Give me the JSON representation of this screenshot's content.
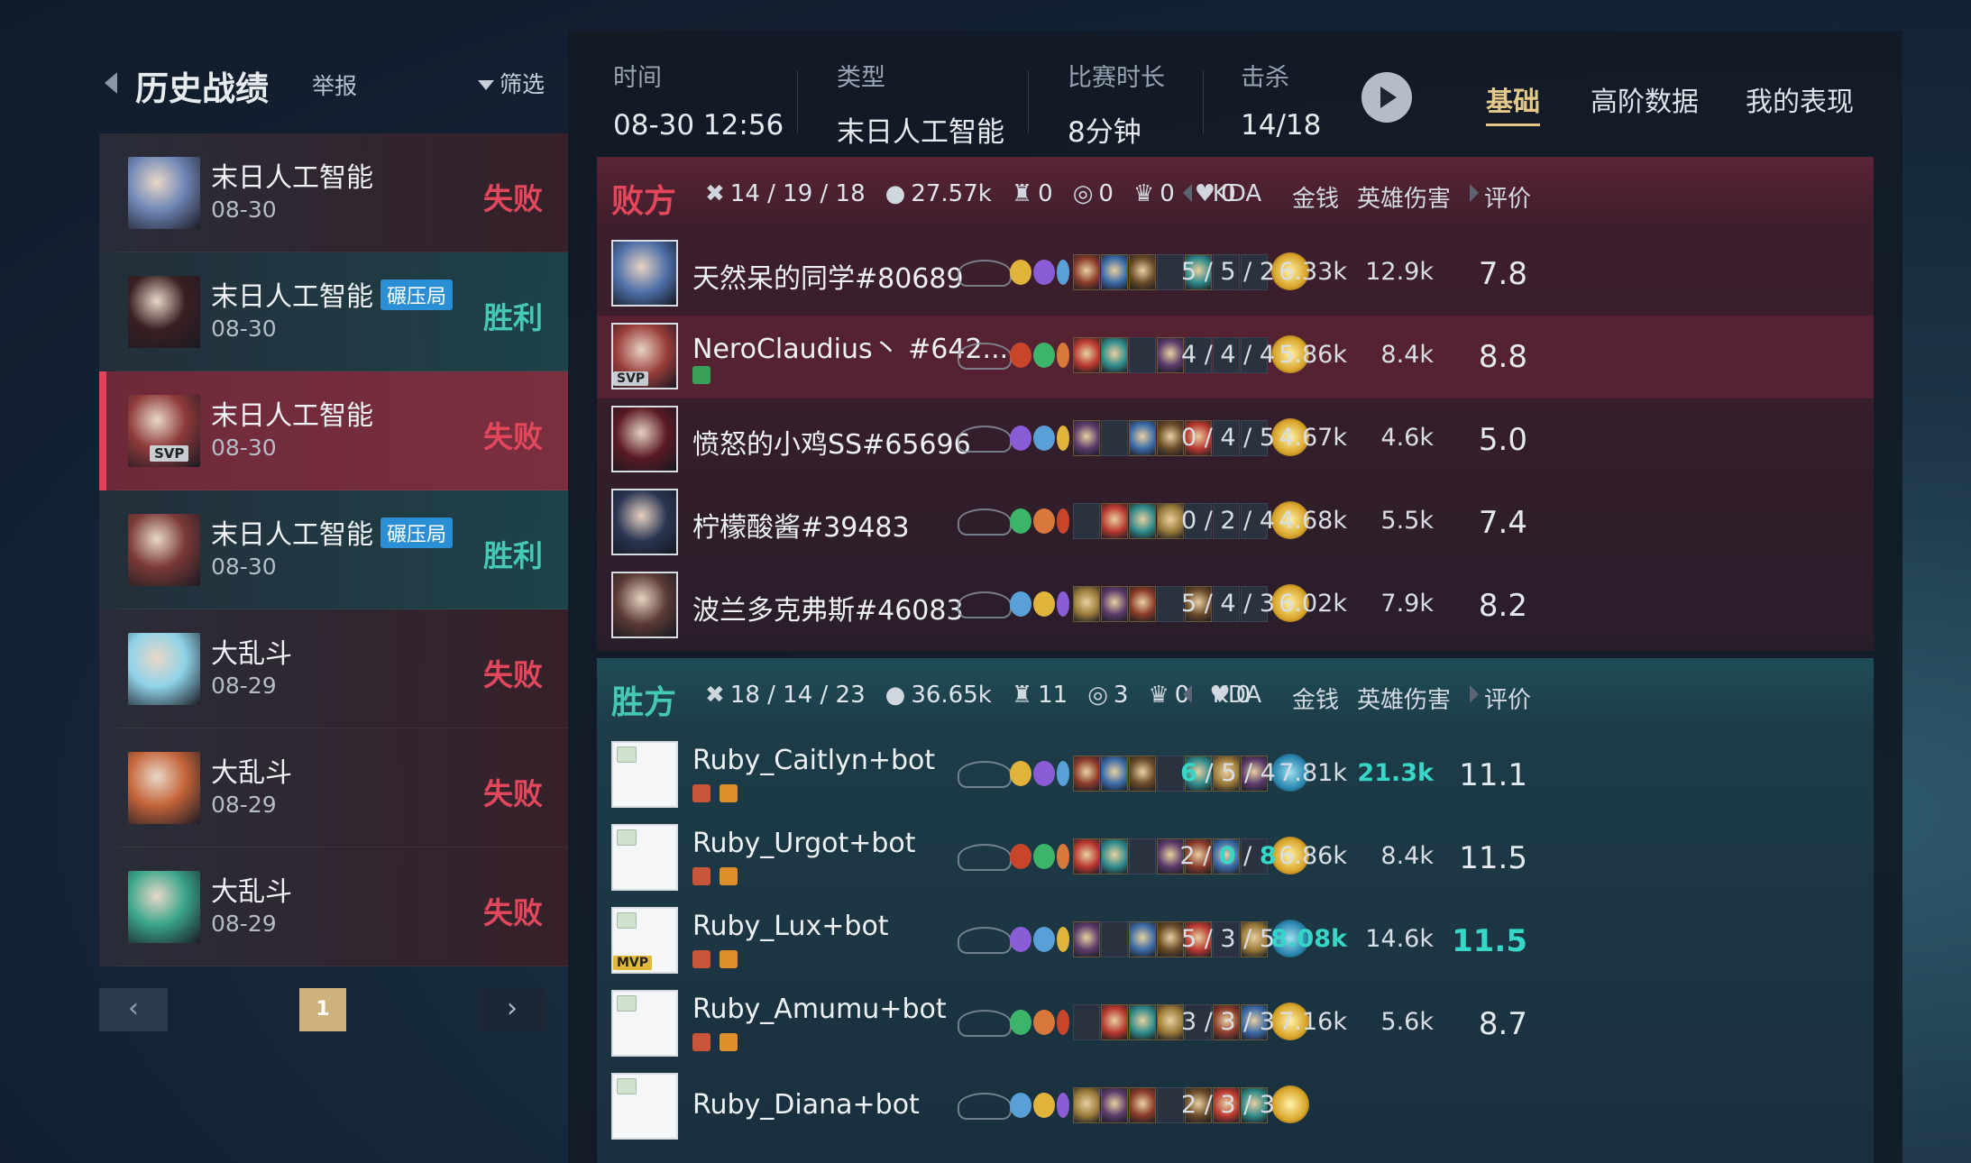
{
  "colors": {
    "lose": "#e2475c",
    "win": "#45c9b5",
    "accent_gold": "#e5c98b",
    "highlight_teal": "#37d7c7",
    "tag_blue": "#2b8fd6"
  },
  "left": {
    "title": "历史战绩",
    "report": "举报",
    "filter": "筛选",
    "matches": [
      {
        "mode": "末日人工智能",
        "tag": "",
        "date": "08-30",
        "result": "失败",
        "outcome": "lose",
        "badge": "",
        "icon_color": "#6f86b6"
      },
      {
        "mode": "末日人工智能",
        "tag": "碾压局",
        "date": "08-30",
        "result": "胜利",
        "outcome": "win",
        "badge": "",
        "icon_color": "#3a1f22"
      },
      {
        "mode": "末日人工智能",
        "tag": "",
        "date": "08-30",
        "result": "失败",
        "outcome": "lose",
        "badge": "SVP",
        "icon_color": "#8e3a3a",
        "selected": true
      },
      {
        "mode": "末日人工智能",
        "tag": "碾压局",
        "date": "08-30",
        "result": "胜利",
        "outcome": "win",
        "badge": "",
        "icon_color": "#7a3a36"
      },
      {
        "mode": "大乱斗",
        "tag": "",
        "date": "08-29",
        "result": "失败",
        "outcome": "lose",
        "badge": "",
        "icon_color": "#8fd2e8"
      },
      {
        "mode": "大乱斗",
        "tag": "",
        "date": "08-29",
        "result": "失败",
        "outcome": "lose",
        "badge": "",
        "icon_color": "#c4643a"
      },
      {
        "mode": "大乱斗",
        "tag": "",
        "date": "08-29",
        "result": "失败",
        "outcome": "lose",
        "badge": "",
        "icon_color": "#3aa58a"
      }
    ],
    "pager": {
      "prev": "‹",
      "page": "1",
      "next": "›"
    }
  },
  "info": {
    "time_label": "时间",
    "time_value": "08-30 12:56",
    "type_label": "类型",
    "type_value": "末日人工智能",
    "duration_label": "比赛时长",
    "duration_value": "8分钟",
    "kills_label": "击杀",
    "kills_value": "14/18"
  },
  "tabs": [
    "基础",
    "高阶数据",
    "我的表现"
  ],
  "columns": {
    "kda": "KDA",
    "gold": "金钱",
    "damage": "英雄伤害",
    "score": "评价"
  },
  "losing": {
    "title": "败方",
    "kda": "14 / 19 / 18",
    "gold": "27.57k",
    "towers": "0",
    "inhibs": "0",
    "barons": "0",
    "dragons": "0",
    "players": [
      {
        "name": "天然呆的同学#80689",
        "kda": "5 / 5 / 2",
        "gold": "6.33k",
        "damage": "12.9k",
        "score": "7.8",
        "avatar": "#4e6fa8",
        "badge": ""
      },
      {
        "name": "NeroClaudius丶 #642...",
        "kda": "4 / 4 / 4",
        "gold": "5.86k",
        "damage": "8.4k",
        "score": "8.8",
        "avatar": "#9a3d3a",
        "badge": "SVP",
        "highlight": true
      },
      {
        "name": "愤怒的小鸡SS#65696",
        "kda": "0 / 4 / 5",
        "gold": "4.67k",
        "damage": "4.6k",
        "score": "5.0",
        "avatar": "#5a1a24",
        "badge": ""
      },
      {
        "name": "柠檬酸酱#39483",
        "kda": "0 / 2 / 4",
        "gold": "4.68k",
        "damage": "5.5k",
        "score": "7.4",
        "avatar": "#2a3552",
        "badge": ""
      },
      {
        "name": "波兰多克弗斯#46083",
        "kda": "5 / 4 / 3",
        "gold": "6.02k",
        "damage": "7.9k",
        "score": "8.2",
        "avatar": "#5a3a34",
        "badge": ""
      }
    ]
  },
  "winning": {
    "title": "胜方",
    "kda": "18 / 14 / 23",
    "gold": "36.65k",
    "towers": "11",
    "inhibs": "3",
    "barons": "0",
    "dragons": "0",
    "players": [
      {
        "name": "Ruby_Caitlyn+bot",
        "k": "6",
        "d": "5",
        "a": "4",
        "gold": "7.81k",
        "damage": "21.3k",
        "score": "11.1",
        "badge": "",
        "hi_k": true,
        "hi_dmg": true
      },
      {
        "name": "Ruby_Urgot+bot",
        "k": "2",
        "d": "0",
        "a": "8",
        "gold": "6.86k",
        "damage": "8.4k",
        "score": "11.5",
        "badge": "",
        "hi_d": true,
        "hi_a": true
      },
      {
        "name": "Ruby_Lux+bot",
        "k": "5",
        "d": "3",
        "a": "5",
        "gold": "8.08k",
        "damage": "14.6k",
        "score": "11.5",
        "badge": "MVP",
        "hi_gold": true,
        "hi_score": true
      },
      {
        "name": "Ruby_Amumu+bot",
        "k": "3",
        "d": "3",
        "a": "3",
        "gold": "7.16k",
        "damage": "5.6k",
        "score": "8.7",
        "badge": ""
      },
      {
        "name": "Ruby_Diana+bot",
        "k": "2",
        "d": "3",
        "a": "3",
        "gold": "",
        "damage": "",
        "score": "",
        "badge": ""
      }
    ]
  }
}
